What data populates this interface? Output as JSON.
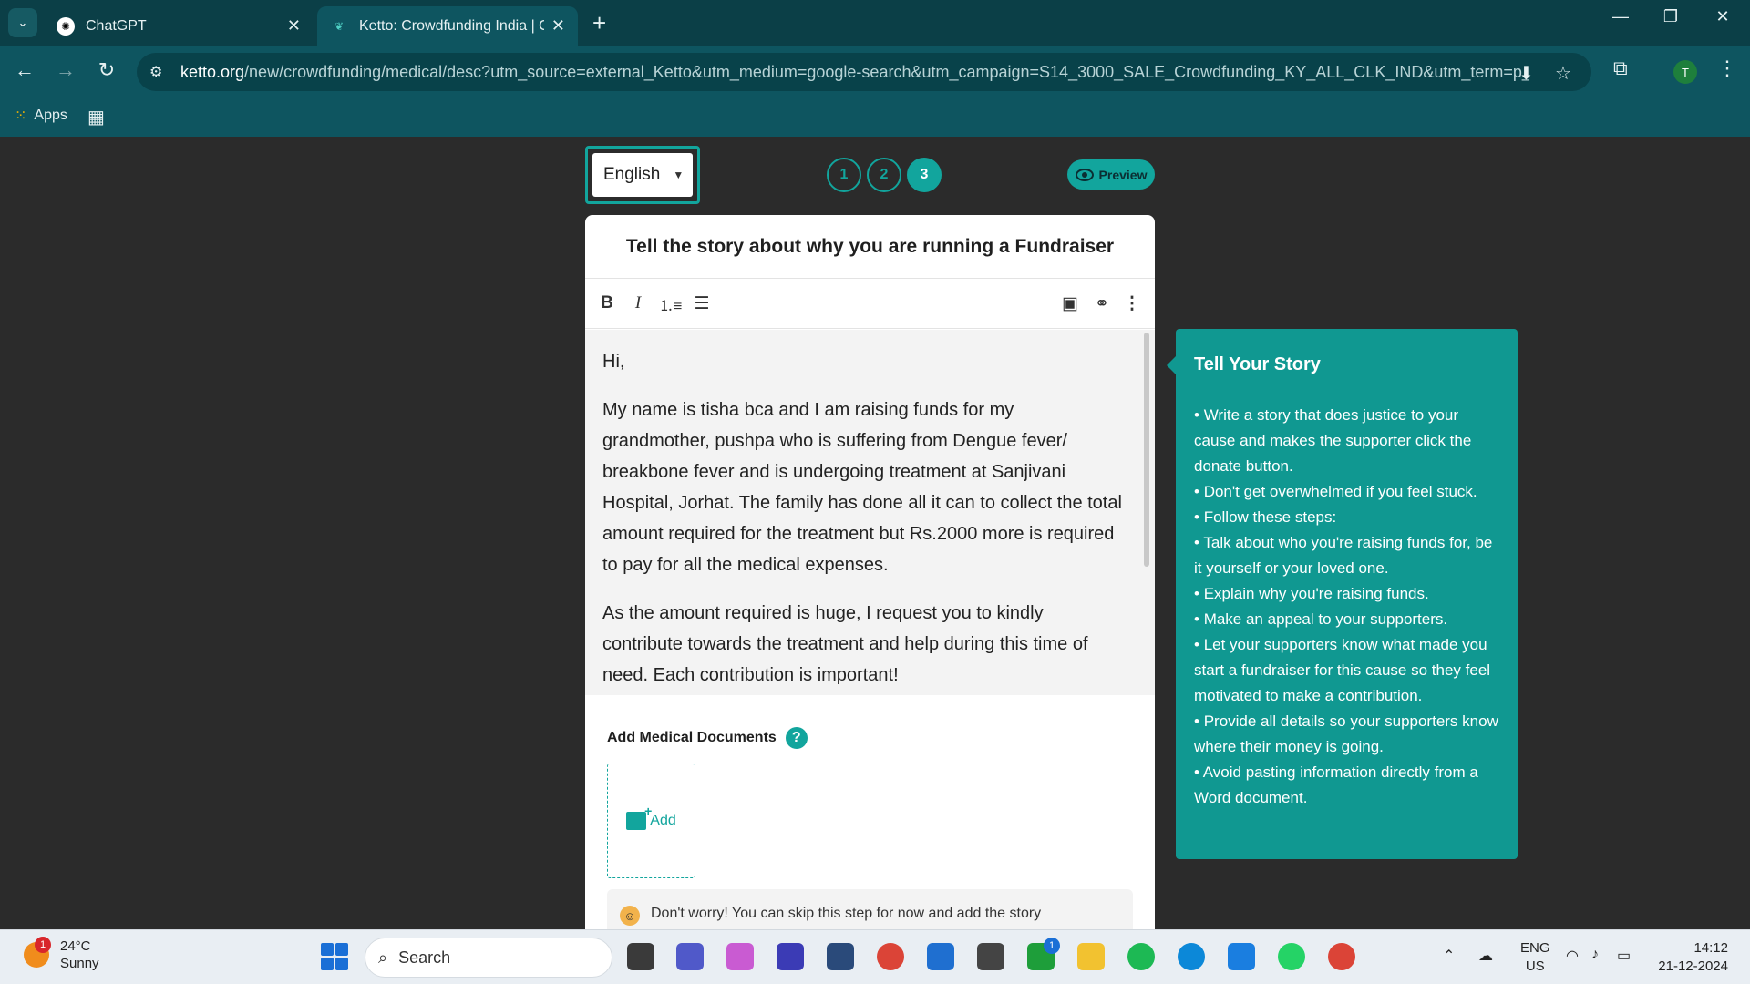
{
  "browser": {
    "tabs": [
      {
        "title": "ChatGPT",
        "icon": "chatgpt-icon"
      },
      {
        "title": "Ketto: Crowdfunding India | Onl",
        "icon": "ketto-icon"
      }
    ],
    "url_host": "ketto.org",
    "url_path": "/new/crowdfunding/medical/desc?utm_source=external_Ketto&utm_medium=google-search&utm_campaign=S14_3000_SALE_Crowdfunding_KY_ALL_CLK_IND&utm_term=p_cr...",
    "profile_initial": "T",
    "bookmarks": {
      "apps_label": "Apps"
    }
  },
  "page": {
    "language": "English",
    "steps": [
      "1",
      "2",
      "3"
    ],
    "active_step": 3,
    "preview_label": "Preview",
    "card_title": "Tell the story about why you are running a Fundraiser",
    "story": [
      "Hi,",
      "My name is tisha bca and I am raising funds for my grandmother, pushpa who is suffering from Dengue fever/ breakbone fever and is undergoing treatment at Sanjivani Hospital, Jorhat. The family has done all it can to collect the total amount required for the treatment but Rs.2000 more is required to pay for all the medical expenses.",
      "As the amount required is huge, I request you to kindly contribute towards the treatment and help during this time of need. Each contribution is important!"
    ],
    "docs_label": "Add Medical Documents",
    "help_symbol": "?",
    "add_label": "Add",
    "notice": "Don't worry! You can skip this step for now and add the story",
    "accent": "#12a59d"
  },
  "tips": {
    "title": "Tell Your Story",
    "items": [
      "Write a story that does justice to your cause and makes the supporter click the donate button.",
      "Don't get overwhelmed if you feel stuck.",
      "Follow these steps:",
      "Talk about who you're raising funds for, be it yourself or your loved one.",
      "Explain why you're raising funds.",
      "Make an appeal to your supporters.",
      "Let your supporters know what made you start a fundraiser for this cause so they feel motivated to make a contribution.",
      "Provide all details so your supporters know where their money is going.",
      "Avoid pasting information directly from a Word document."
    ]
  },
  "taskbar": {
    "temp": "24°C",
    "condition": "Sunny",
    "weather_badge": "1",
    "search_placeholder": "Search",
    "lang_line1": "ENG",
    "lang_line2": "US",
    "time": "14:12",
    "date": "21-12-2024",
    "xbox_badge": "1"
  }
}
